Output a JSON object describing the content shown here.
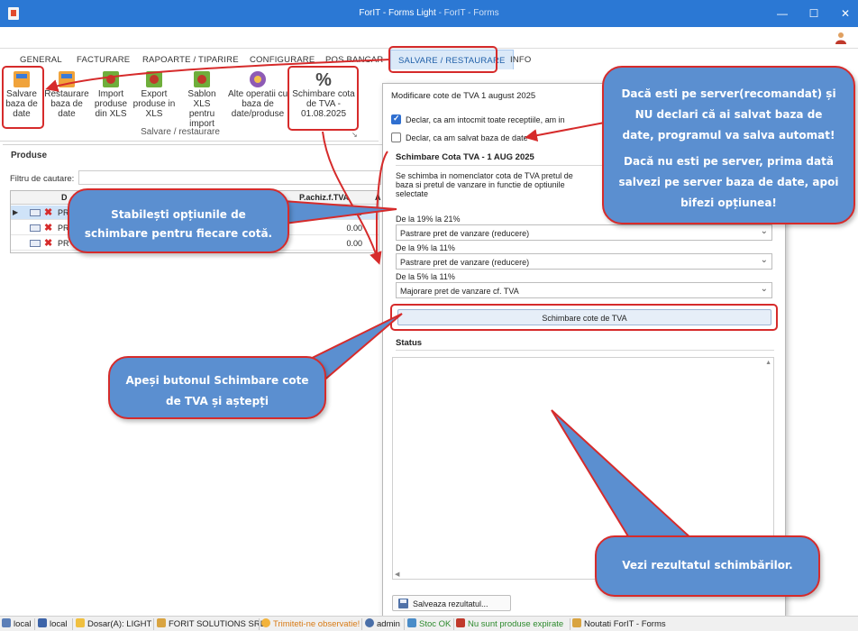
{
  "window": {
    "title": "ForIT - Forms Light",
    "subtitle": "ForIT - Forms",
    "minimize": "—",
    "maximize": "☐",
    "close": "✕"
  },
  "menu": {
    "tabs": [
      "GENERAL",
      "FACTURARE",
      "RAPOARTE / TIPARIRE",
      "CONFIGURARE",
      "POS BANCAR",
      "SALVARE / RESTAURARE",
      "INFO"
    ],
    "active": "SALVARE / RESTAURARE"
  },
  "ribbon": {
    "buttons": [
      {
        "line1": "Salvare",
        "line2": "baza de",
        "line3": "date",
        "icon": "database-save-icon"
      },
      {
        "line1": "Restaurare",
        "line2": "baza de",
        "line3": "date",
        "icon": "database-restore-icon"
      },
      {
        "line1": "Import",
        "line2": "produse",
        "line3": "din XLS",
        "icon": "import-xls-icon"
      },
      {
        "line1": "Export",
        "line2": "produse in",
        "line3": "XLS",
        "icon": "export-xls-icon"
      },
      {
        "line1": "Sablon XLS",
        "line2": "pentru",
        "line3": "import",
        "icon": "xls-template-icon"
      },
      {
        "line1": "Alte operatii cu",
        "line2": "baza de",
        "line3": "date/produse",
        "icon": "gear-icon"
      },
      {
        "line1": "Schimbare cota",
        "line2": "de TVA -",
        "line3": "01.08.2025",
        "icon": "percent-icon"
      }
    ],
    "group_label": "Salvare / restaurare",
    "percent_symbol": "%"
  },
  "produse": {
    "title": "Produse",
    "filter_label": "Filtru de cautare:",
    "columns": {
      "d": "D",
      "price": "P.achiz.f.TVA",
      "a": "A"
    },
    "rows": [
      {
        "name": "PR",
        "value": "0.00"
      },
      {
        "name": "PR",
        "value": "0.00"
      },
      {
        "name": "PR",
        "value": "0.00"
      }
    ]
  },
  "dialog": {
    "title": "Modificare cote de TVA 1 august 2025",
    "check1_label": "Declar, ca am intocmit toate receptiile, am in",
    "check2_label": "Declar, ca am salvat baza de date",
    "section_title": "Schimbare Cota TVA - 1 AUG 2025",
    "description": "Se schimba in nomenclator cota de TVA pretul de baza si pretul de vanzare in functie de optiunile selectate",
    "rates": [
      {
        "label": "De la 19% la 21%",
        "option": "Pastrare pret de vanzare (reducere)"
      },
      {
        "label": "De la 9% la 11%",
        "option": "Pastrare pret de vanzare (reducere)"
      },
      {
        "label": "De la 5% la 11%",
        "option": "Majorare pret de vanzare cf. TVA"
      }
    ],
    "apply_button": "Schimbare cote de TVA",
    "status_title": "Status",
    "save_button": "Salveaza rezultatul...",
    "check1_checked": true,
    "check2_checked": false
  },
  "callouts": {
    "server_p1": "Dacă esti pe server(recomandat) și NU declari că ai salvat baza de date, programul va salva automat!",
    "server_p2": "Dacă nu esti pe server, prima dată salvezi pe server baza de date, apoi bifezi opțiunea!",
    "options": "Stabilești opțiunile de schimbare pentru fiecare cotă.",
    "button": "Apeși butonul Schimbare cote de TVA și aștepți",
    "result": "Vezi rezultatul schimbărilor."
  },
  "statusbar": {
    "items": [
      "local",
      "local",
      "Dosar(A): LIGHT",
      "FORIT SOLUTIONS SRL",
      "Trimiteti-ne observatie!",
      "admin",
      "Stoc OK",
      "Nu sunt produse expirate",
      "Noutati ForIT - Forms"
    ]
  },
  "colors": {
    "titlebar": "#2b78d4",
    "callout_fill": "#5b8fd0",
    "callout_border": "#d62b2b",
    "accent": "#2f6fd0"
  }
}
